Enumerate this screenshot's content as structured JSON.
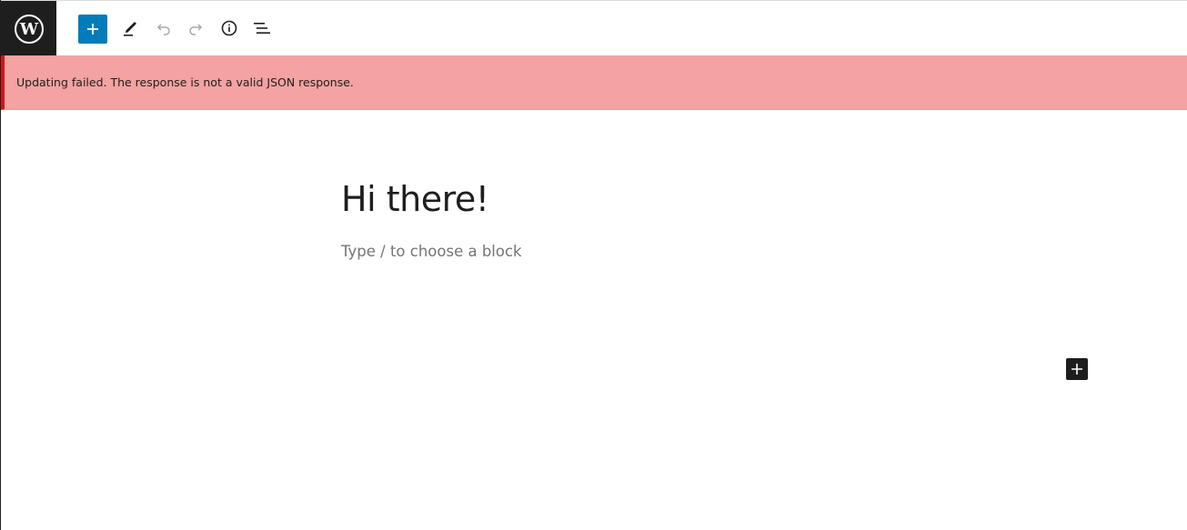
{
  "toolbar": {
    "logo_icon": "wordpress-logo-icon",
    "buttons": [
      {
        "icon": "plus-icon",
        "label": "Toggle block inserter",
        "state": "enabled"
      },
      {
        "icon": "pencil-icon",
        "label": "Tools",
        "state": "enabled"
      },
      {
        "icon": "undo-icon",
        "label": "Undo",
        "state": "disabled"
      },
      {
        "icon": "redo-icon",
        "label": "Redo",
        "state": "disabled"
      },
      {
        "icon": "info-icon",
        "label": "Details",
        "state": "enabled"
      },
      {
        "icon": "list-view-icon",
        "label": "List View",
        "state": "enabled"
      }
    ]
  },
  "notice": {
    "message": "Updating failed. The response is not a valid JSON response."
  },
  "editor": {
    "post_title": "Hi there!",
    "block_placeholder": "Type / to choose a block"
  },
  "colors": {
    "accent": "#007cba",
    "toolbar_dark": "#1e1e1e",
    "error_background": "#f4a2a2",
    "error_border": "#cc1818",
    "placeholder_text": "#757575",
    "disabled_icon": "#a7aaad"
  }
}
